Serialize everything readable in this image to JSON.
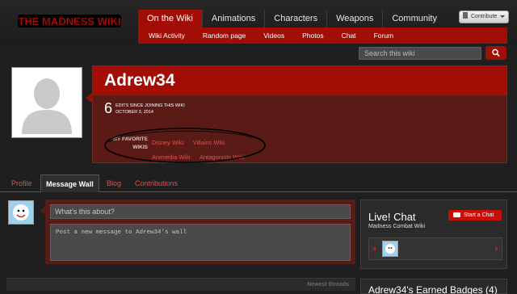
{
  "logo": {
    "text": "THE MADNESS WIKI"
  },
  "nav": {
    "tabs": [
      {
        "label": "On the Wiki",
        "active": true
      },
      {
        "label": "Animations"
      },
      {
        "label": "Characters"
      },
      {
        "label": "Weapons"
      },
      {
        "label": "Community"
      }
    ],
    "subtabs": [
      "Wiki Activity",
      "Random page",
      "Videos",
      "Photos",
      "Chat",
      "Forum"
    ]
  },
  "contribute": {
    "label": "Contribute"
  },
  "search": {
    "placeholder": "Search this wiki"
  },
  "profile": {
    "username": "Adrew34",
    "edits_count": "6",
    "edits_label": "EDITS SINCE JOINING THIS WIKI",
    "edits_date": "OCTOBER 3, 2014",
    "favorite_label_1": "MY FAVORITE",
    "favorite_label_2": "WIKIS",
    "favorite_wikis": [
      "Disney Wiki",
      "Villains Wiki",
      "Animedia Wiki",
      "Antagonists Wiki"
    ]
  },
  "profile_tabs": [
    {
      "label": "Profile"
    },
    {
      "label": "Message Wall",
      "active": true
    },
    {
      "label": "Blog"
    },
    {
      "label": "Contributions"
    }
  ],
  "wall": {
    "subject_placeholder": "What's this about?",
    "body_placeholder": "Post a new message to Adrew34's wall",
    "sort_label": "Newest threads"
  },
  "chat": {
    "title": "Live! Chat",
    "wiki_name": "Madness Combat Wiki",
    "start_label": "Start a Chat"
  },
  "badges": {
    "title": "Adrew34's Earned Badges (4)"
  },
  "colors": {
    "accent": "#a20e05",
    "dark_red": "#5a1b16",
    "link": "#e05050",
    "background": "#1f1f1f"
  },
  "icons": [
    "user-silhouette-icon",
    "search-icon",
    "chat-bubble-icon",
    "page-icon",
    "chevron-down-icon"
  ]
}
